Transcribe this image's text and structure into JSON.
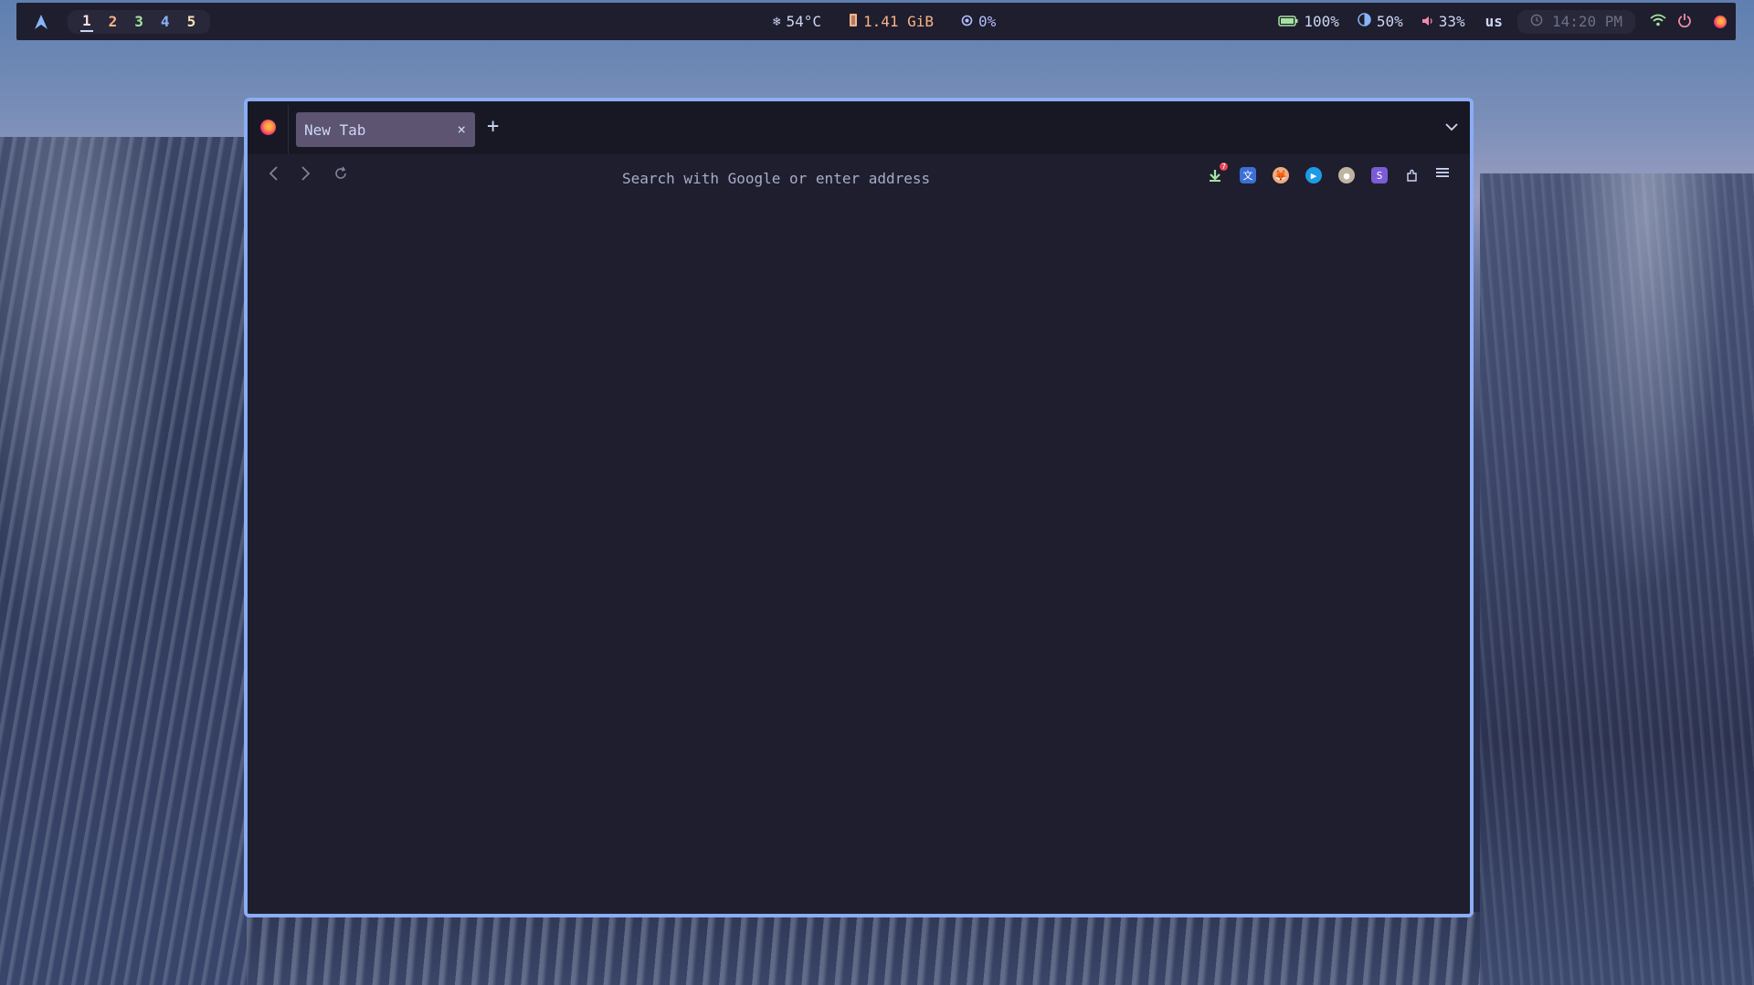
{
  "topbar": {
    "workspaces": [
      "1",
      "2",
      "3",
      "4",
      "5"
    ],
    "workspace_colors": [
      "#f5e0dc",
      "#fab387",
      "#a6e3a1",
      "#89b4fa",
      "#f9e2af"
    ],
    "temperature": "54°C",
    "memory": "1.41 GiB",
    "cpu": "0%",
    "battery": "100%",
    "brightness": "50%",
    "volume": "33%",
    "keyboard_layout": "us",
    "clock": "14:20 PM"
  },
  "browser": {
    "tab_title": "New Tab",
    "tab_close": "×",
    "new_tab": "+",
    "url_placeholder": "Search with Google or enter address",
    "ext_badge": "7"
  },
  "colors": {
    "bar_bg": "#1e1e2e",
    "accent_border": "#8aadf4",
    "temp": "#cdd6f4",
    "memory": "#fab387",
    "cpu": "#b4befe",
    "battery": "#a6e3a1",
    "brightness": "#89b4fa",
    "volume": "#f38ba8",
    "power": "#f38ba8"
  },
  "icons": {
    "launcher": "arch-logo-icon",
    "temp": "snowflake-icon",
    "memory": "memory-icon",
    "cpu": "cpu-icon",
    "battery": "battery-icon",
    "brightness": "brightness-icon",
    "volume": "volume-icon",
    "clock": "clock-icon",
    "wifi": "wifi-icon",
    "power": "power-icon",
    "firefox": "firefox-logo-icon"
  }
}
